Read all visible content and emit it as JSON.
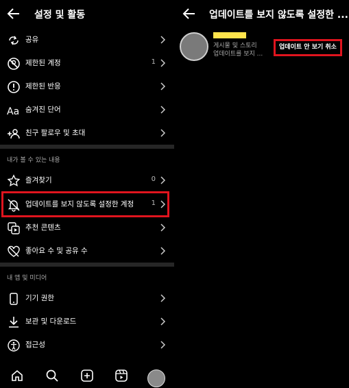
{
  "left": {
    "title": "설정 및 활동",
    "rows_top": [
      {
        "label": "공유",
        "count": ""
      },
      {
        "label": "제한된 계정",
        "count": "1"
      },
      {
        "label": "제한된 반응",
        "count": ""
      },
      {
        "label": "숨겨진 단어",
        "count": ""
      },
      {
        "label": "친구 팔로우 및 초대",
        "count": ""
      }
    ],
    "section1": "내가 볼 수 있는 내용",
    "rows_mid": [
      {
        "label": "즐겨찾기",
        "count": "0"
      },
      {
        "label": "업데이트를 보지 않도록 설정한 계정",
        "count": "1"
      },
      {
        "label": "추천 콘텐츠",
        "count": ""
      },
      {
        "label": "좋아요 수 및 공유 수",
        "count": ""
      }
    ],
    "section2": "내 앱 및 미디어",
    "rows_bottom": [
      {
        "label": "기기 권한",
        "count": ""
      },
      {
        "label": "보관 및 다운로드",
        "count": ""
      },
      {
        "label": "접근성",
        "count": ""
      }
    ]
  },
  "right": {
    "title": "업데이트를 보지 않도록 설정한 ...",
    "desc_line1": "게시물 및 스토리",
    "desc_line2": "업데이트를 보지 ...",
    "undo_button": "업데이트 안 보기 취소"
  },
  "colors": {
    "highlight": "#e0141e",
    "background": "#000000"
  }
}
